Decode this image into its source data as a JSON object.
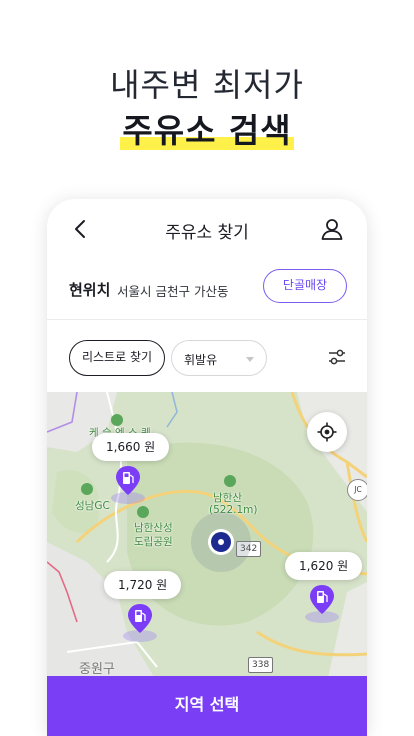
{
  "promo": {
    "line1": "내주변 최저가",
    "line2": "주유소 검색",
    "highlight_color": "#fff04a"
  },
  "header": {
    "title": "주유소 찾기",
    "back_icon": "chevron-left-icon",
    "profile_icon": "person-icon"
  },
  "location": {
    "label": "현위치",
    "address": "서울시 금천구 가산동",
    "regular_button": "단골매장"
  },
  "filters": {
    "list_button": "리스트로 찾기",
    "fuel_selected": "휘발유",
    "filter_icon": "sliders-icon"
  },
  "map": {
    "prices": [
      "1,660 원",
      "1,620 원",
      "1,720 원"
    ],
    "labels": {
      "mountain": "남한산",
      "mountain_height": "(522.1m)",
      "park_line1": "남한산성",
      "park_line2": "도립공원",
      "golf": "성남GC",
      "place_top": "케 슬 엔 스 퀘",
      "district": "중원구",
      "road_342": "342",
      "road_338": "338",
      "junction": "JC"
    },
    "locate_icon": "crosshair-icon"
  },
  "bottom_button": "지역 선택",
  "colors": {
    "accent": "#7a3ff5",
    "pin": "#7b3ef6"
  }
}
